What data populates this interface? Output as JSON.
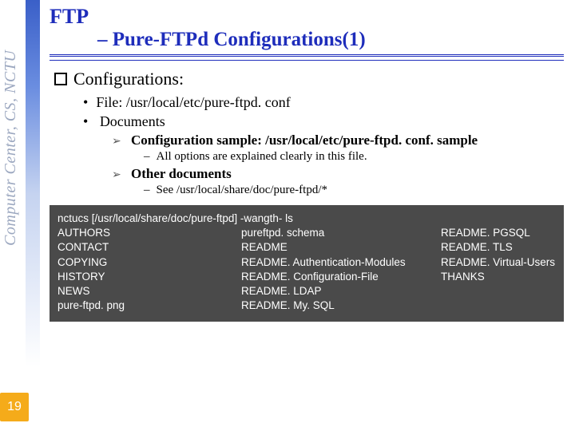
{
  "sidebar": {
    "label": "Computer Center, CS, NCTU"
  },
  "page_number": "19",
  "title": {
    "line1": "FTP",
    "line2": "– Pure-FTPd Configurations(1)"
  },
  "section_heading": "Configurations:",
  "bullets": {
    "file": "File: /usr/local/etc/pure-ftpd. conf",
    "documents": "Documents",
    "config_sample": "Configuration sample: /usr/local/etc/pure-ftpd. conf. sample",
    "config_sample_sub": "All options are explained clearly in this file.",
    "other_docs": "Other documents",
    "other_docs_sub": "See /usr/local/share/doc/pure-ftpd/*"
  },
  "terminal": {
    "prompt": "nctucs [/usr/local/share/doc/pure-ftpd] -wangth- ls",
    "rows": [
      {
        "c1": "AUTHORS",
        "c2": "pureftpd. schema",
        "c3": "README. PGSQL"
      },
      {
        "c1": "CONTACT",
        "c2": "README",
        "c3": "README. TLS"
      },
      {
        "c1": "COPYING",
        "c2": "README. Authentication-Modules",
        "c3": "README. Virtual-Users"
      },
      {
        "c1": "HISTORY",
        "c2": "README. Configuration-File",
        "c3": "THANKS"
      },
      {
        "c1": "NEWS",
        "c2": "README. LDAP",
        "c3": ""
      },
      {
        "c1": "pure-ftpd. png",
        "c2": "README. My. SQL",
        "c3": ""
      }
    ]
  }
}
